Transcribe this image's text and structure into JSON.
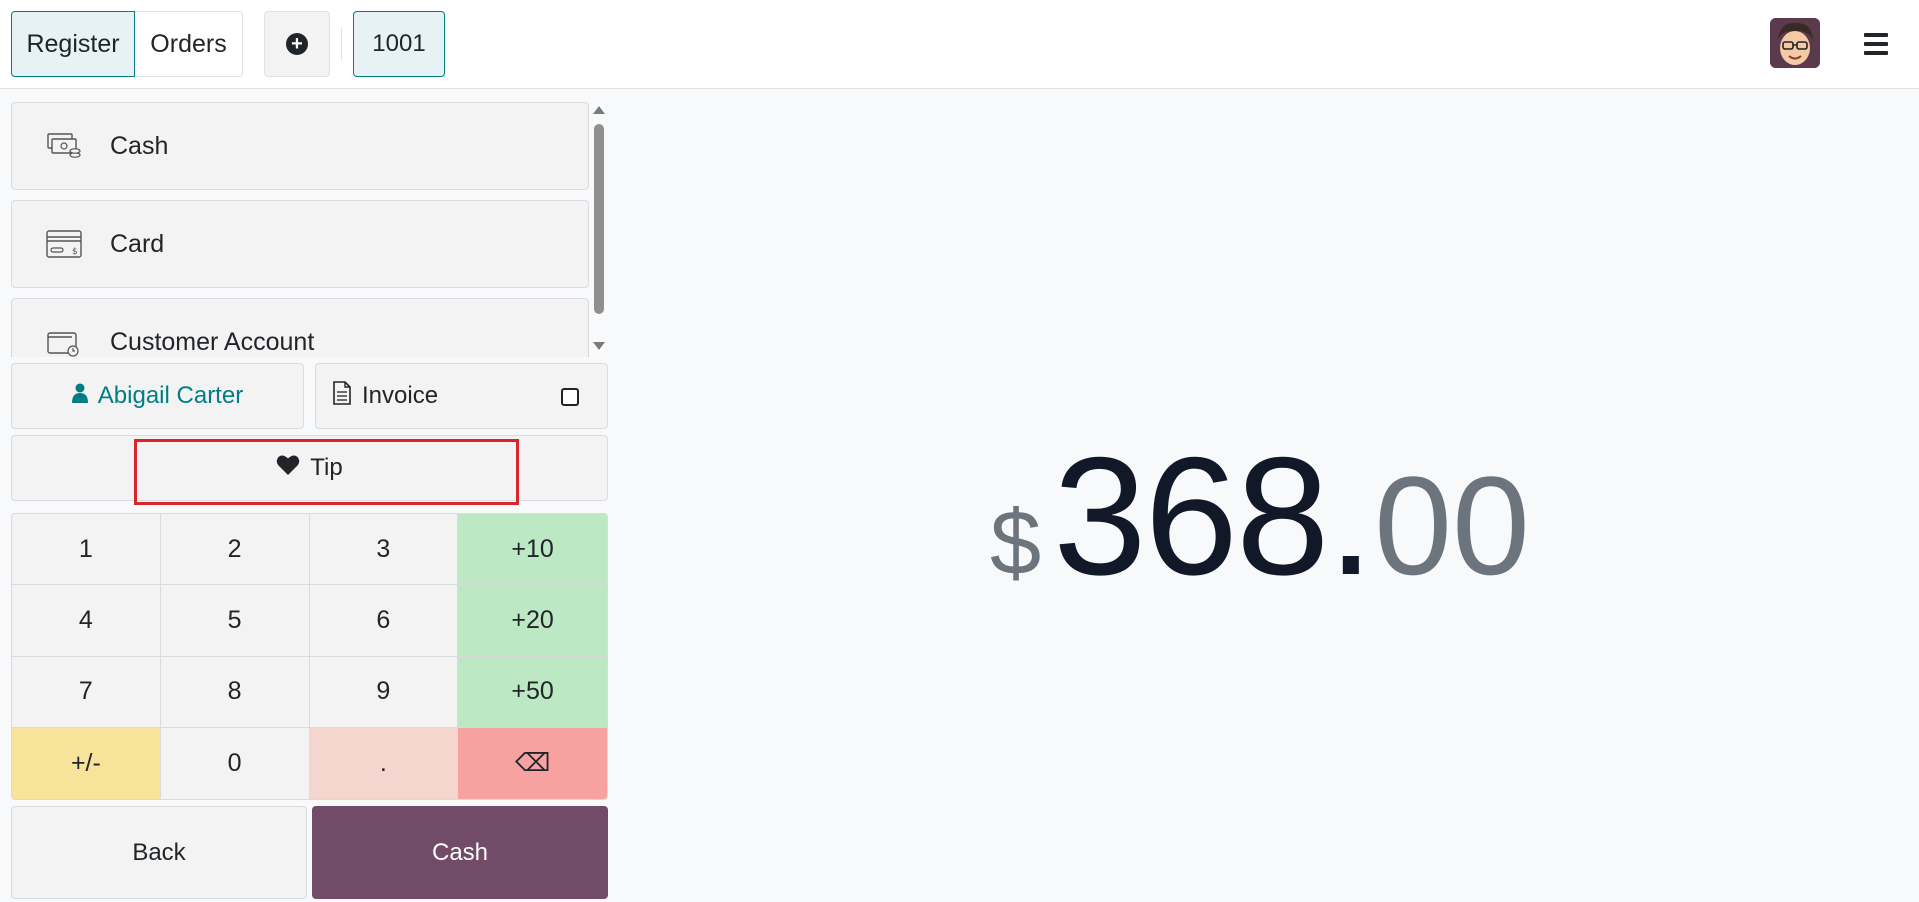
{
  "header": {
    "tabs": [
      {
        "label": "Register",
        "active": true
      },
      {
        "label": "Orders",
        "active": false
      }
    ],
    "order_number": "1001",
    "icons": {
      "new_order": "plus-circle-icon",
      "avatar": "user-avatar",
      "menu": "hamburger-menu-icon"
    }
  },
  "payment_methods": [
    {
      "label": "Cash",
      "icon": "cash-icon"
    },
    {
      "label": "Card",
      "icon": "card-icon"
    },
    {
      "label": "Customer Account",
      "icon": "wallet-icon"
    }
  ],
  "customer": {
    "name": "Abigail Carter",
    "icon": "user-icon"
  },
  "invoice": {
    "label": "Invoice",
    "checked": false,
    "icon": "document-icon"
  },
  "tip": {
    "label": "Tip",
    "icon": "heart-icon"
  },
  "numpad": {
    "keys": [
      "1",
      "2",
      "3",
      "+10",
      "4",
      "5",
      "6",
      "+20",
      "7",
      "8",
      "9",
      "+50",
      "+/-",
      "0",
      ".",
      "⌫"
    ]
  },
  "actions": {
    "back": "Back",
    "validate": "Cash"
  },
  "total": {
    "currency": "$",
    "integer": "368",
    "separator": ".",
    "decimals": "00"
  },
  "colors": {
    "accent": "#017e84",
    "primary": "#714b67",
    "highlight": "#d7262e",
    "quick_add": "#bce8c4",
    "sign": "#f7e39a",
    "decimal": "#f5d6cf",
    "backspace": "#f8a1a1"
  }
}
